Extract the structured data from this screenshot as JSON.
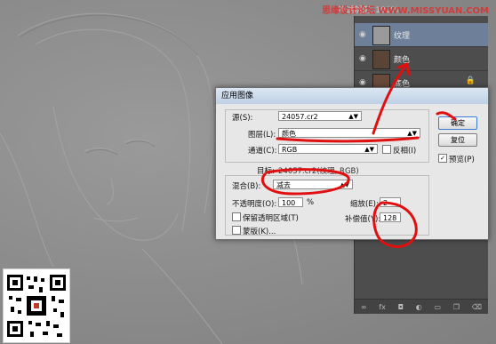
{
  "watermark": "思缘设计论坛 WWW.MISSYUAN.COM",
  "watermark_small": "不透明度: 100%",
  "layers": [
    {
      "name": "纹理",
      "active": true
    },
    {
      "name": "颜色",
      "active": false
    },
    {
      "name": "底色",
      "active": false,
      "locked": true
    }
  ],
  "dialog": {
    "title": "应用图像",
    "source_label": "源(S):",
    "source_value": "24057.cr2",
    "layer_label": "图层(L):",
    "layer_value": "颜色",
    "channel_label": "通道(C):",
    "channel_value": "RGB",
    "invert_label": "反相(I)",
    "target_label": "目标:",
    "target_value": "24057.cr2(纹理, RGB)",
    "blending_label": "混合(B):",
    "blending_value": "减去",
    "opacity_label": "不透明度(O):",
    "opacity_value": "100",
    "opacity_unit": "%",
    "scale_label": "缩放(E):",
    "scale_value": "2",
    "offset_label": "补偿值(Y):",
    "offset_value": "128",
    "preserve_label": "保留透明区域(T)",
    "mask_label": "蒙版(K)...",
    "ok_label": "确定",
    "reset_label": "复位",
    "preview_label": "预览(P)",
    "preview_checked": "✓"
  },
  "colors": {
    "annotation": "#e01010",
    "dialog_bg": "#e7e7e7",
    "active_layer": "#6d7f99"
  }
}
